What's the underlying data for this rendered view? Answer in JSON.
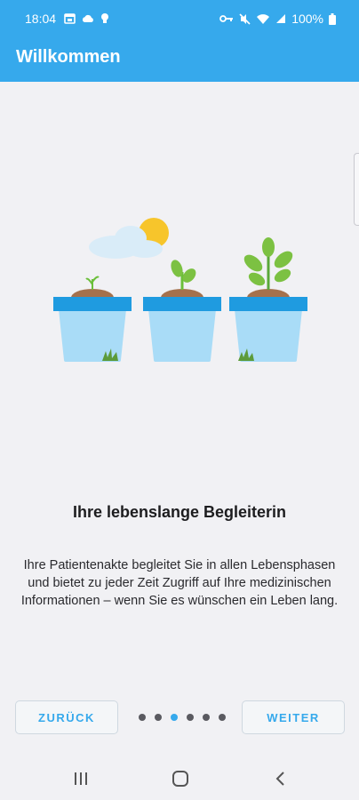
{
  "status_bar": {
    "time": "18:04",
    "battery": "100%",
    "left_icons": [
      "calendar-icon",
      "cloud-icon",
      "lightbulb-icon"
    ],
    "right_icons": [
      "key-icon",
      "mute-icon",
      "wifi-icon",
      "signal-icon",
      "battery-icon"
    ]
  },
  "app_bar": {
    "title": "Willkommen"
  },
  "onboarding": {
    "heading": "Ihre lebenslange Begleiterin",
    "body": "Ihre Patientenakte begleitet Sie in allen Lebensphasen und bietet zu jeder Zeit Zugriff auf Ihre medizinischen Informationen – wenn Sie es wünschen ein Leben lang.",
    "page_index": 3,
    "page_count": 6
  },
  "buttons": {
    "back": "ZURÜCK",
    "next": "WEITER"
  },
  "nav_bar": {
    "icons": [
      "recent-apps-icon",
      "home-icon",
      "back-icon"
    ]
  },
  "colors": {
    "primary": "#36a9ec",
    "pot": "#a9dcf7",
    "pot_rim": "#1f9be0",
    "background": "#f1f1f4"
  }
}
